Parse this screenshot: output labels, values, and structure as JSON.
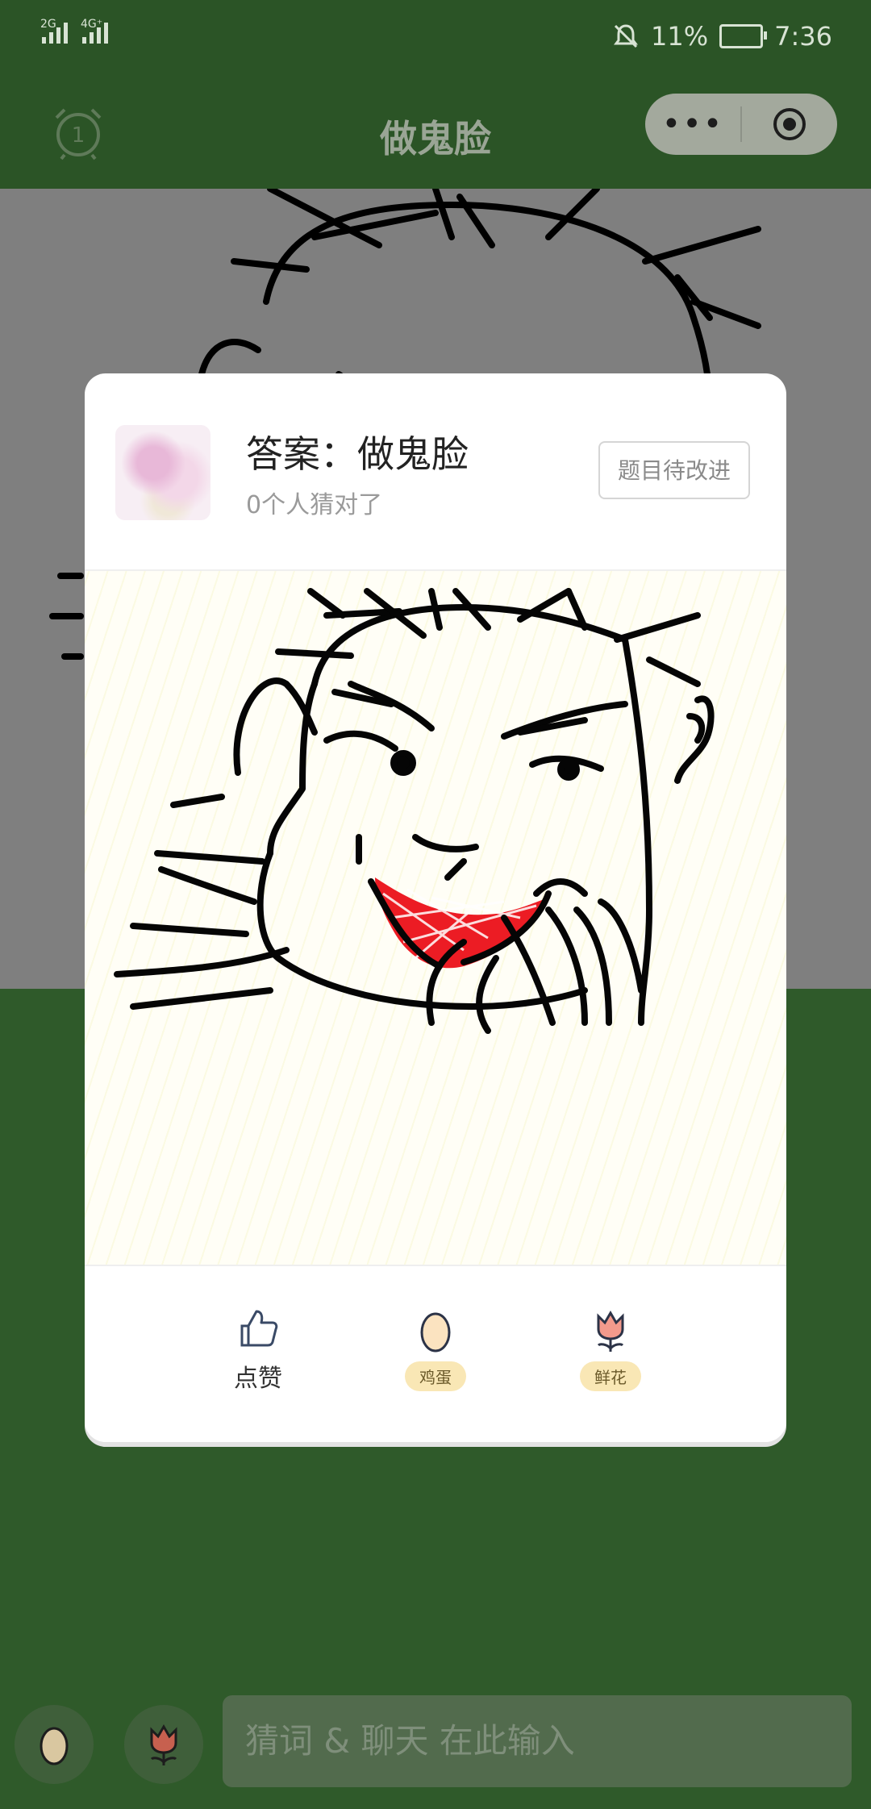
{
  "status_bar": {
    "signal1": "2G",
    "signal2": "4G⁺",
    "battery_pct": "11%",
    "time": "7:36"
  },
  "navbar": {
    "title": "做鬼脸",
    "alarm_badge": "1",
    "menu_icon": "more-dots-icon",
    "close_icon": "target-icon"
  },
  "modal": {
    "answer": "答案：做鬼脸",
    "guessed": "0个人猜对了",
    "improve_button": "题目待改进",
    "actions": [
      {
        "icon": "thumbs-up-icon",
        "label": "点赞"
      },
      {
        "icon": "egg-icon",
        "label": "鸡蛋"
      },
      {
        "icon": "flower-icon",
        "label": "鲜花"
      }
    ]
  },
  "bottom_bar": {
    "egg_icon": "egg-icon",
    "flower_icon": "flower-icon",
    "input_placeholder": "猜词 & 聊天 在此输入"
  },
  "colors": {
    "page_green": "#2f5a2a",
    "lip_red": "#ec1c24",
    "pill_yellow": "#f9e7b5"
  }
}
